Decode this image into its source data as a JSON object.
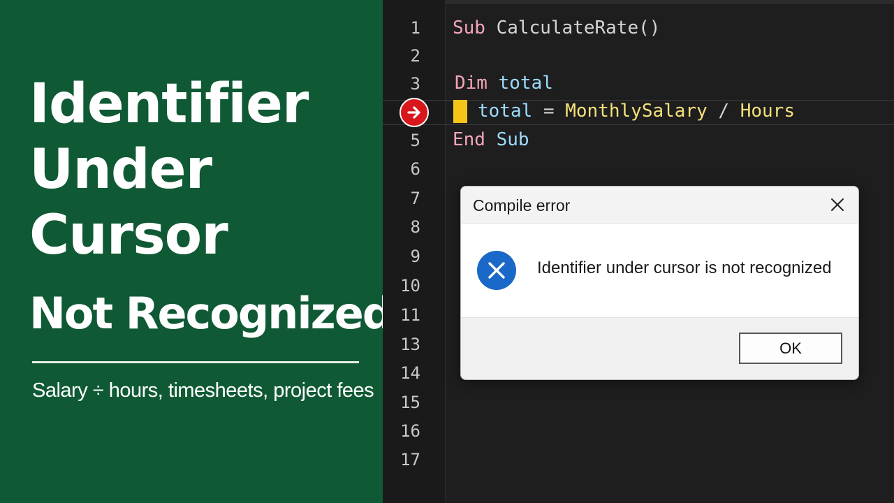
{
  "thumbnail": {
    "title_lines": [
      "Identifier",
      "Under",
      "Cursor",
      "Not Recognized"
    ],
    "subtitle": "Salary ÷ hours, timesheets, project fees",
    "background_color": "#0f5a35"
  },
  "editor": {
    "line_numbers": [
      "1",
      "2",
      "3",
      "",
      "5",
      "6",
      "7",
      "8",
      "9",
      "10",
      "11",
      "13",
      "14",
      "15",
      "16",
      "17"
    ],
    "code": {
      "line1_keyword": "Sub",
      "line1_name": "CalculateRate()",
      "line3_keyword": "Dim",
      "line3_var": "total",
      "line4_var": "total",
      "line4_eq": "=",
      "line4_operand1": "MonthlySalary",
      "line4_op": "/",
      "line4_operand2": "Hours",
      "line5_keyword1": "End",
      "line5_keyword2": "Sub"
    },
    "breakpoint_icon": "arrow-right-icon",
    "exec_marker_color": "#f5c518"
  },
  "dialog": {
    "title": "Compile error",
    "close_icon": "close-icon",
    "message": "Identifier under cursor is not recognized",
    "icon": "error-x-icon",
    "ok_label": "OK"
  }
}
